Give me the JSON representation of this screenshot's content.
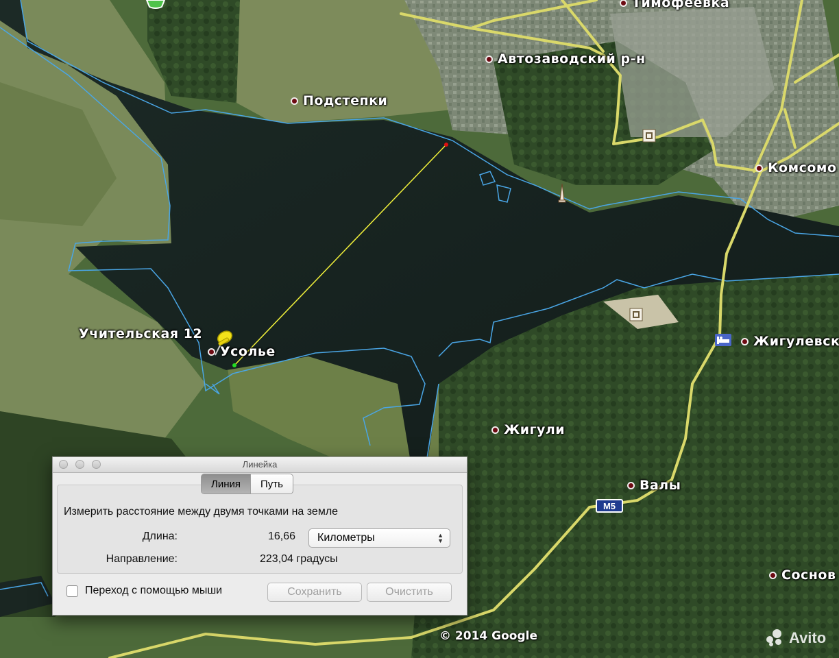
{
  "map": {
    "places": [
      {
        "name": "Тимофеевка"
      },
      {
        "name": "Автозаводский р-н"
      },
      {
        "name": "Подстепки"
      },
      {
        "name": "Комсомо"
      },
      {
        "name": "Учительская 12"
      },
      {
        "name": "Усолье"
      },
      {
        "name": "Жигулевск"
      },
      {
        "name": "Жигули"
      },
      {
        "name": "Валы"
      },
      {
        "name": "Соснов"
      }
    ],
    "road_shield": "M5",
    "copyright": "© 2014 Google",
    "watermark": "Avito"
  },
  "ruler": {
    "title": "Линейка",
    "tabs": [
      {
        "label": "Линия",
        "active": true
      },
      {
        "label": "Путь",
        "active": false
      }
    ],
    "description": "Измерить расстояние между двумя точками на земле",
    "length_label": "Длина:",
    "length_value": "16,66",
    "units": "Километры",
    "heading_label": "Направление:",
    "heading_value": "223,04 градусы",
    "mouse_nav_label": "Переход с помощью мыши",
    "mouse_nav_checked": false,
    "save_label": "Сохранить",
    "clear_label": "Очистить"
  }
}
